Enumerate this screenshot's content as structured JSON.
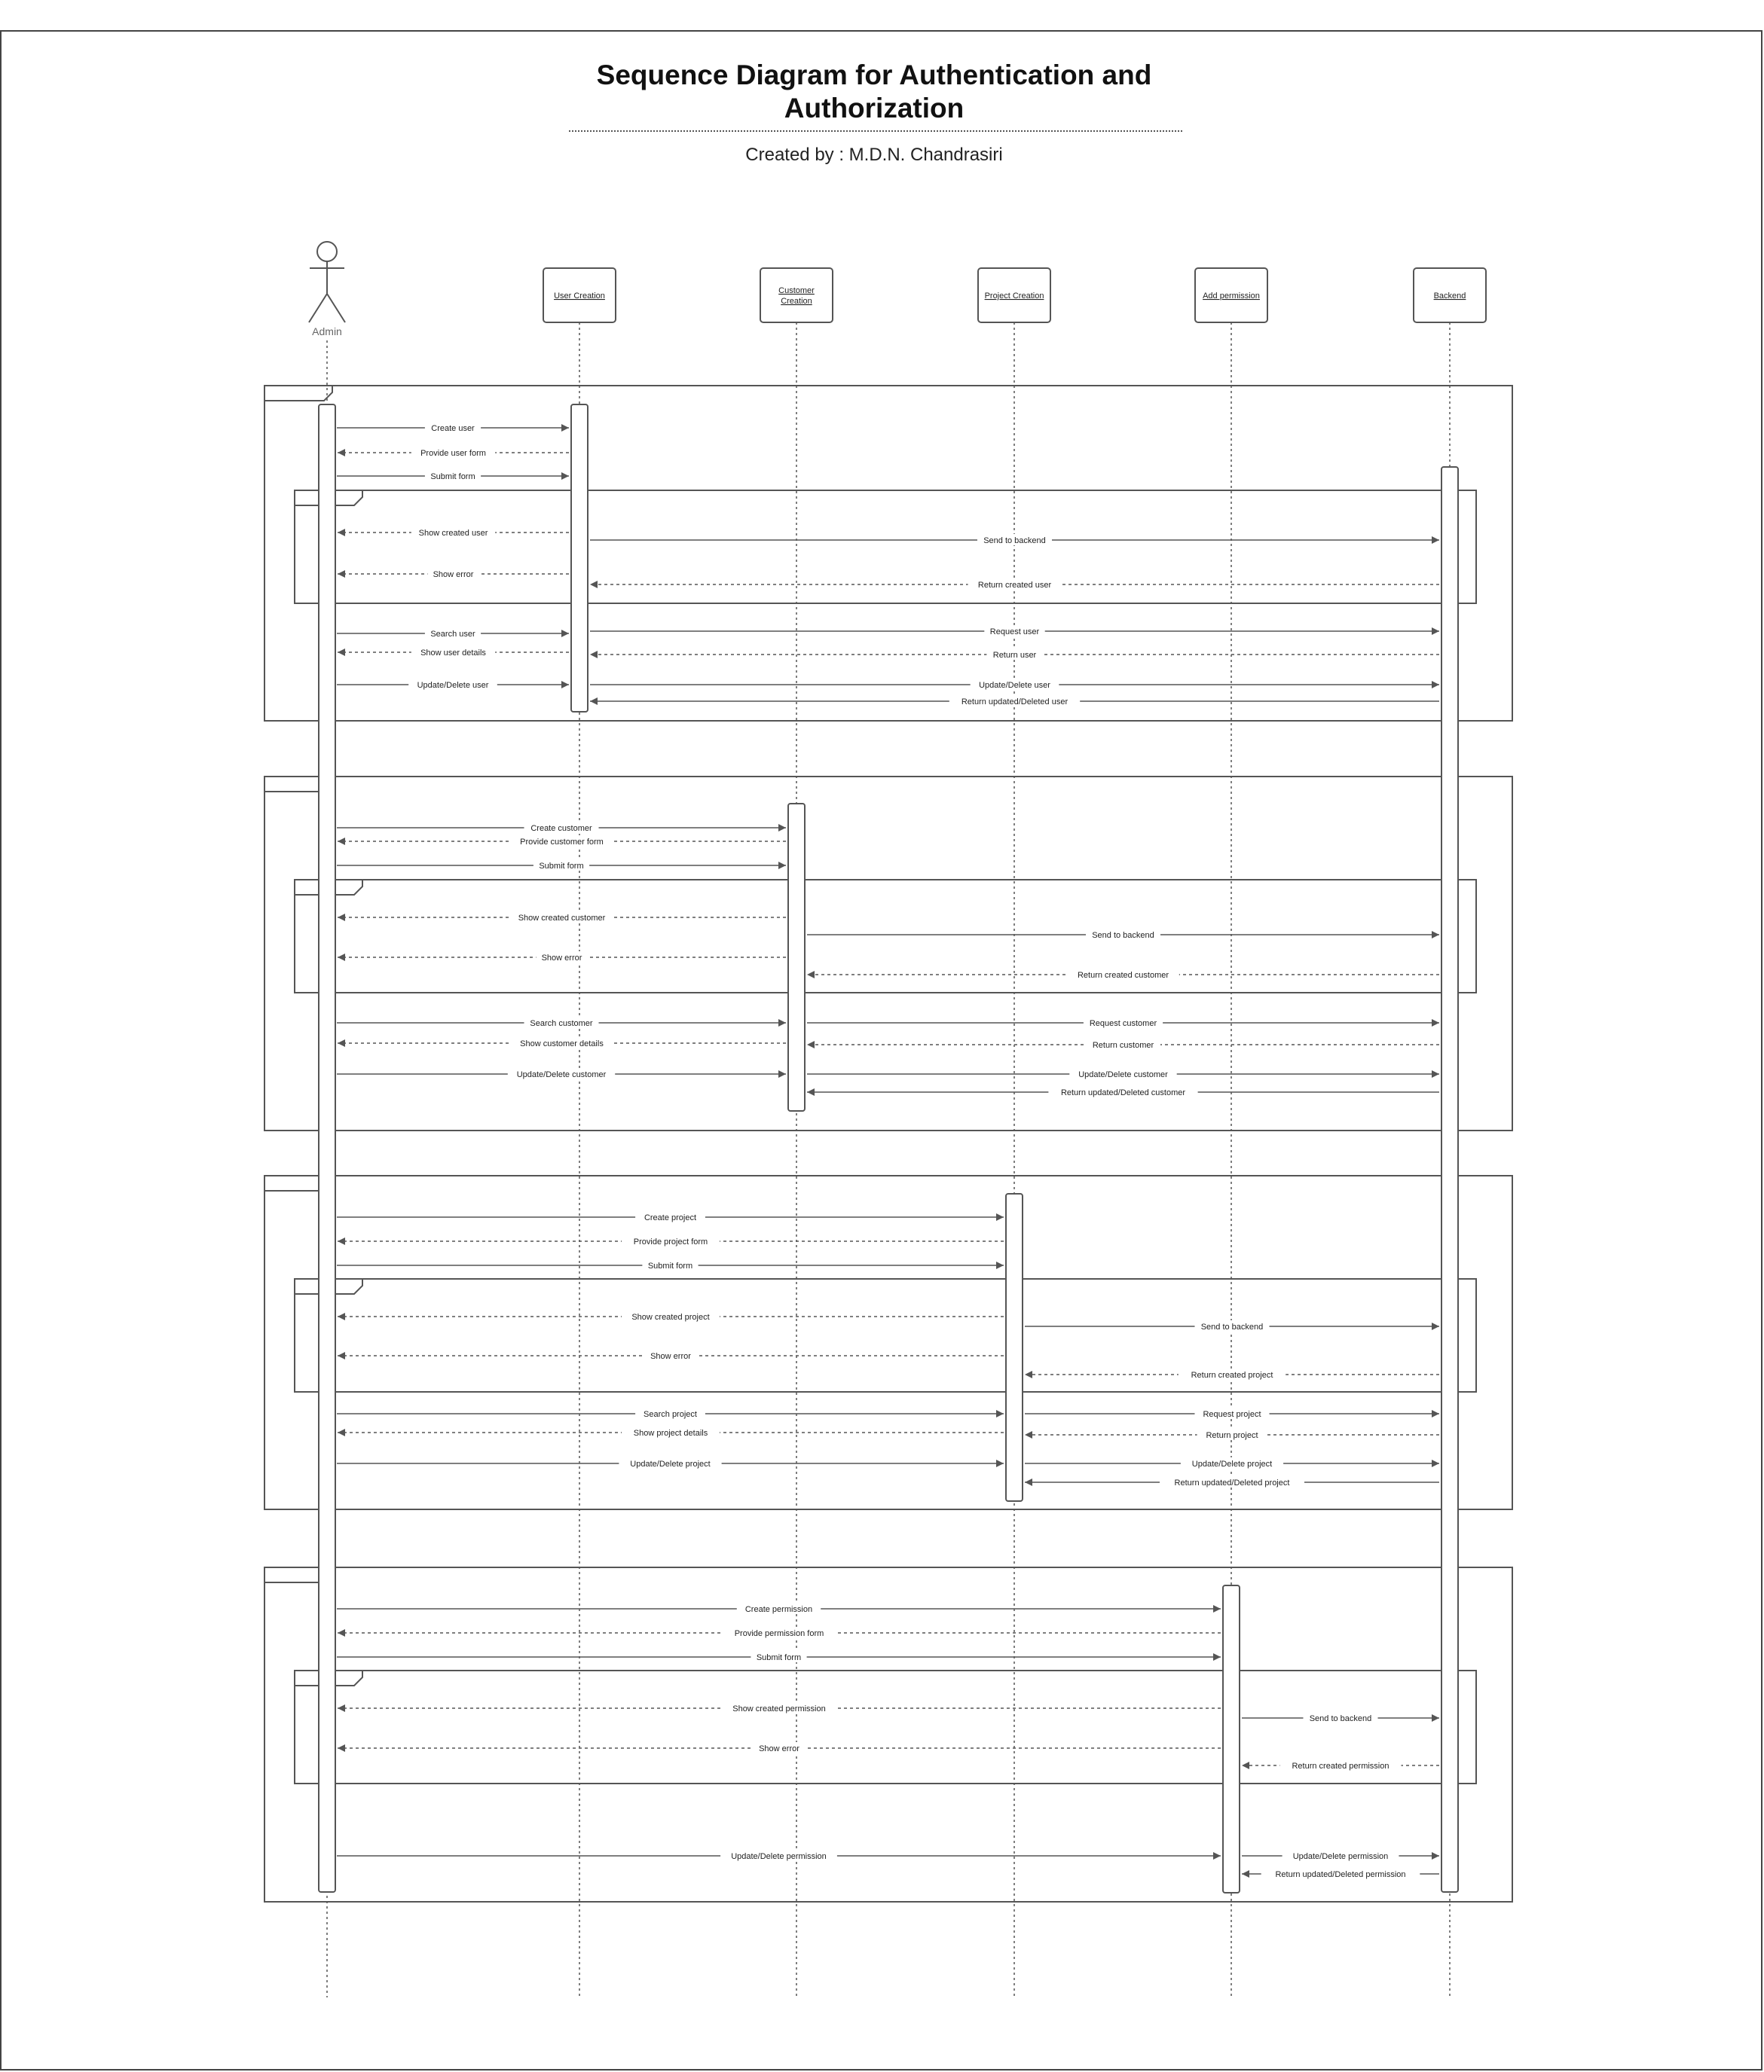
{
  "title": "Sequence Diagram for Authentication and Authorization",
  "subtitle": "Created by : M.D.N. Chandrasiri",
  "actor": {
    "label": "Admin",
    "icon": "stick-figure-actor-icon"
  },
  "lifelines": [
    {
      "id": "user_creation",
      "label_lines": [
        "User Creation"
      ]
    },
    {
      "id": "customer_creation",
      "label_lines": [
        "Customer",
        "Creation"
      ]
    },
    {
      "id": "project_creation",
      "label_lines": [
        "Project Creation"
      ]
    },
    {
      "id": "add_permission",
      "label_lines": [
        "Add permission"
      ]
    },
    {
      "id": "backend",
      "label_lines": [
        "Backend"
      ]
    }
  ],
  "sections": [
    {
      "name": "user",
      "messages": [
        {
          "from": "admin",
          "to": "user_creation",
          "label": "Create user",
          "style": "solid"
        },
        {
          "from": "user_creation",
          "to": "admin",
          "label": "Provide user form",
          "style": "dashed"
        },
        {
          "from": "admin",
          "to": "user_creation",
          "label": "Submit form",
          "style": "solid"
        },
        {
          "from": "user_creation",
          "to": "admin",
          "label": "Show created user",
          "style": "dashed"
        },
        {
          "from": "user_creation",
          "to": "backend",
          "label": "Send to backend",
          "style": "solid"
        },
        {
          "from": "user_creation",
          "to": "admin",
          "label": "Show error",
          "style": "dashed"
        },
        {
          "from": "backend",
          "to": "user_creation",
          "label": "Return created user",
          "style": "dashed"
        },
        {
          "from": "user_creation",
          "to": "backend",
          "label": "Request user",
          "style": "solid"
        },
        {
          "from": "admin",
          "to": "user_creation",
          "label": "Search user",
          "style": "solid"
        },
        {
          "from": "user_creation",
          "to": "admin",
          "label": "Show user details",
          "style": "dashed"
        },
        {
          "from": "backend",
          "to": "user_creation",
          "label": "Return user",
          "style": "dashed"
        },
        {
          "from": "admin",
          "to": "user_creation",
          "label": "Update/Delete user",
          "style": "solid"
        },
        {
          "from": "user_creation",
          "to": "backend",
          "label": "Update/Delete user",
          "style": "solid"
        },
        {
          "from": "backend",
          "to": "user_creation",
          "label": "Return updated/Deleted user",
          "style": "solid"
        }
      ]
    },
    {
      "name": "customer",
      "messages": [
        {
          "from": "admin",
          "to": "customer_creation",
          "label": "Create customer",
          "style": "solid"
        },
        {
          "from": "customer_creation",
          "to": "admin",
          "label": "Provide customer form",
          "style": "dashed"
        },
        {
          "from": "admin",
          "to": "customer_creation",
          "label": "Submit form",
          "style": "solid"
        },
        {
          "from": "customer_creation",
          "to": "admin",
          "label": "Show created customer",
          "style": "dashed"
        },
        {
          "from": "customer_creation",
          "to": "backend",
          "label": "Send to backend",
          "style": "solid"
        },
        {
          "from": "customer_creation",
          "to": "admin",
          "label": "Show error",
          "style": "dashed"
        },
        {
          "from": "backend",
          "to": "customer_creation",
          "label": "Return created customer",
          "style": "dashed"
        },
        {
          "from": "admin",
          "to": "customer_creation",
          "label": "Search customer",
          "style": "solid"
        },
        {
          "from": "customer_creation",
          "to": "backend",
          "label": "Request customer",
          "style": "solid"
        },
        {
          "from": "customer_creation",
          "to": "admin",
          "label": "Show customer details",
          "style": "dashed"
        },
        {
          "from": "backend",
          "to": "customer_creation",
          "label": "Return customer",
          "style": "dashed"
        },
        {
          "from": "admin",
          "to": "customer_creation",
          "label": "Update/Delete customer",
          "style": "solid"
        },
        {
          "from": "customer_creation",
          "to": "backend",
          "label": "Update/Delete customer",
          "style": "solid"
        },
        {
          "from": "backend",
          "to": "customer_creation",
          "label": "Return updated/Deleted customer",
          "style": "solid"
        }
      ]
    },
    {
      "name": "project",
      "messages": [
        {
          "from": "admin",
          "to": "project_creation",
          "label": "Create project",
          "style": "solid"
        },
        {
          "from": "project_creation",
          "to": "admin",
          "label": "Provide project form",
          "style": "dashed"
        },
        {
          "from": "admin",
          "to": "project_creation",
          "label": "Submit form",
          "style": "solid"
        },
        {
          "from": "project_creation",
          "to": "admin",
          "label": "Show created project",
          "style": "dashed"
        },
        {
          "from": "project_creation",
          "to": "backend",
          "label": "Send to backend",
          "style": "solid"
        },
        {
          "from": "project_creation",
          "to": "admin",
          "label": "Show error",
          "style": "dashed"
        },
        {
          "from": "backend",
          "to": "project_creation",
          "label": "Return created project",
          "style": "dashed"
        },
        {
          "from": "admin",
          "to": "project_creation",
          "label": "Search project",
          "style": "solid"
        },
        {
          "from": "project_creation",
          "to": "backend",
          "label": "Request project",
          "style": "solid"
        },
        {
          "from": "project_creation",
          "to": "admin",
          "label": "Show project details",
          "style": "dashed"
        },
        {
          "from": "backend",
          "to": "project_creation",
          "label": "Return project",
          "style": "dashed"
        },
        {
          "from": "admin",
          "to": "project_creation",
          "label": "Update/Delete project",
          "style": "solid"
        },
        {
          "from": "project_creation",
          "to": "backend",
          "label": "Update/Delete project",
          "style": "solid"
        },
        {
          "from": "backend",
          "to": "project_creation",
          "label": "Return updated/Deleted project",
          "style": "solid"
        }
      ]
    },
    {
      "name": "permission",
      "messages": [
        {
          "from": "admin",
          "to": "add_permission",
          "label": "Create permission",
          "style": "solid"
        },
        {
          "from": "add_permission",
          "to": "admin",
          "label": "Provide permission form",
          "style": "dashed"
        },
        {
          "from": "admin",
          "to": "add_permission",
          "label": "Submit form",
          "style": "solid"
        },
        {
          "from": "add_permission",
          "to": "admin",
          "label": "Show created permission",
          "style": "dashed"
        },
        {
          "from": "add_permission",
          "to": "backend",
          "label": "Send to backend",
          "style": "solid"
        },
        {
          "from": "add_permission",
          "to": "admin",
          "label": "Show error",
          "style": "dashed"
        },
        {
          "from": "backend",
          "to": "add_permission",
          "label": "Return created permission",
          "style": "dashed"
        },
        {
          "from": "admin",
          "to": "add_permission",
          "label": "Update/Delete permission",
          "style": "solid"
        },
        {
          "from": "add_permission",
          "to": "backend",
          "label": "Update/Delete permission",
          "style": "solid"
        },
        {
          "from": "backend",
          "to": "add_permission",
          "label": "Return updated/Deleted permission",
          "style": "solid"
        }
      ]
    }
  ],
  "colors": {
    "line": "#555555",
    "text": "#222222",
    "background": "#ffffff"
  }
}
